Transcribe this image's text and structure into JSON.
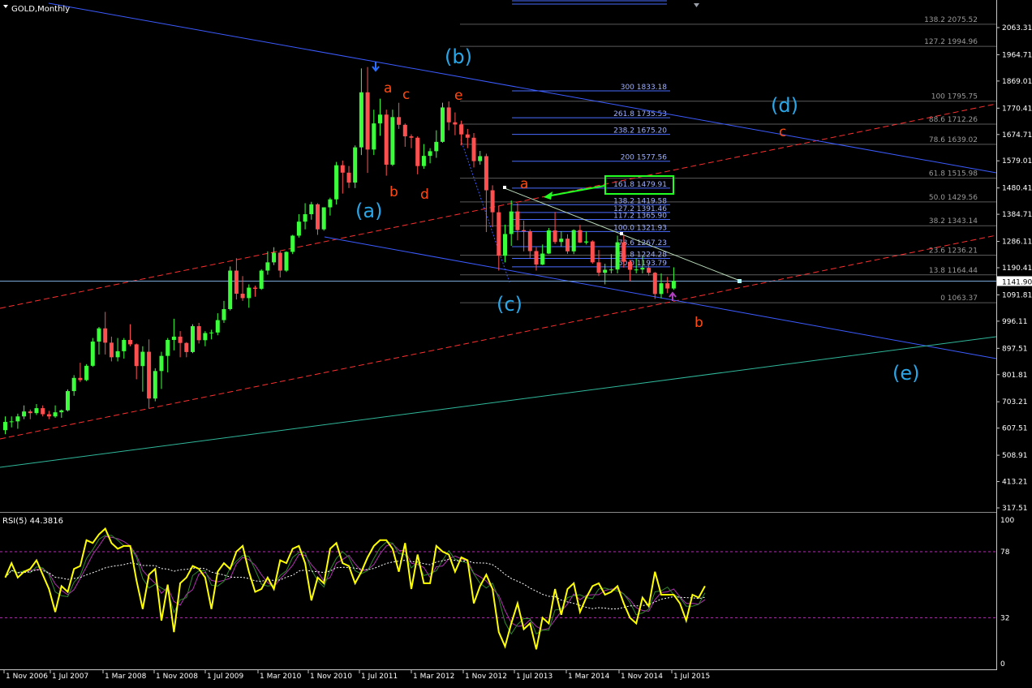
{
  "chart_data": {
    "type": "candlestick",
    "symbol_title": "GOLD,Monthly",
    "price_axis_ticks": [
      "2063.31",
      "1964.71",
      "1869.01",
      "1770.41",
      "1674.71",
      "1579.01",
      "1480.41",
      "1384.71",
      "1286.11",
      "1190.41",
      "1091.81",
      "996.11",
      "897.51",
      "801.81",
      "703.21",
      "607.51",
      "508.91",
      "413.21",
      "317.51"
    ],
    "current_price": "1141.90",
    "time_axis_ticks": [
      "1 Nov 2006",
      "1 Jul 2007",
      "1 Mar 2008",
      "1 Nov 2008",
      "1 Jul 2009",
      "1 Mar 2010",
      "1 Nov 2010",
      "1 Jul 2011",
      "1 Mar 2012",
      "1 Nov 2012",
      "1 Jul 2013",
      "1 Mar 2014",
      "1 Nov 2014",
      "1 Jul 2015"
    ],
    "candles": [
      {
        "d": "2006-11",
        "o": 600,
        "h": 650,
        "l": 585,
        "c": 630
      },
      {
        "d": "2006-12",
        "o": 630,
        "h": 650,
        "l": 610,
        "c": 632
      },
      {
        "d": "2007-01",
        "o": 632,
        "h": 660,
        "l": 605,
        "c": 650
      },
      {
        "d": "2007-02",
        "o": 650,
        "h": 690,
        "l": 640,
        "c": 668
      },
      {
        "d": "2007-03",
        "o": 668,
        "h": 675,
        "l": 640,
        "c": 662
      },
      {
        "d": "2007-04",
        "o": 662,
        "h": 695,
        "l": 655,
        "c": 680
      },
      {
        "d": "2007-05",
        "o": 680,
        "h": 690,
        "l": 650,
        "c": 658
      },
      {
        "d": "2007-06",
        "o": 658,
        "h": 670,
        "l": 640,
        "c": 650
      },
      {
        "d": "2007-07",
        "o": 650,
        "h": 690,
        "l": 645,
        "c": 665
      },
      {
        "d": "2007-08",
        "o": 665,
        "h": 675,
        "l": 645,
        "c": 672
      },
      {
        "d": "2007-09",
        "o": 672,
        "h": 748,
        "l": 668,
        "c": 742
      },
      {
        "d": "2007-10",
        "o": 742,
        "h": 800,
        "l": 725,
        "c": 790
      },
      {
        "d": "2007-11",
        "o": 790,
        "h": 845,
        "l": 775,
        "c": 782
      },
      {
        "d": "2007-12",
        "o": 782,
        "h": 840,
        "l": 778,
        "c": 834
      },
      {
        "d": "2008-01",
        "o": 834,
        "h": 935,
        "l": 830,
        "c": 922
      },
      {
        "d": "2008-02",
        "o": 922,
        "h": 975,
        "l": 875,
        "c": 970
      },
      {
        "d": "2008-03",
        "o": 970,
        "h": 1030,
        "l": 875,
        "c": 918
      },
      {
        "d": "2008-04",
        "o": 918,
        "h": 940,
        "l": 850,
        "c": 865
      },
      {
        "d": "2008-05",
        "o": 865,
        "h": 935,
        "l": 850,
        "c": 887
      },
      {
        "d": "2008-06",
        "o": 887,
        "h": 935,
        "l": 860,
        "c": 928
      },
      {
        "d": "2008-07",
        "o": 928,
        "h": 985,
        "l": 905,
        "c": 912
      },
      {
        "d": "2008-08",
        "o": 912,
        "h": 915,
        "l": 785,
        "c": 833
      },
      {
        "d": "2008-09",
        "o": 833,
        "h": 905,
        "l": 740,
        "c": 885
      },
      {
        "d": "2008-10",
        "o": 885,
        "h": 930,
        "l": 680,
        "c": 715
      },
      {
        "d": "2008-11",
        "o": 715,
        "h": 825,
        "l": 705,
        "c": 815
      },
      {
        "d": "2008-12",
        "o": 815,
        "h": 885,
        "l": 750,
        "c": 870
      },
      {
        "d": "2009-01",
        "o": 870,
        "h": 935,
        "l": 810,
        "c": 928
      },
      {
        "d": "2009-02",
        "o": 928,
        "h": 1005,
        "l": 890,
        "c": 940
      },
      {
        "d": "2009-03",
        "o": 940,
        "h": 960,
        "l": 865,
        "c": 917
      },
      {
        "d": "2009-04",
        "o": 917,
        "h": 920,
        "l": 865,
        "c": 884
      },
      {
        "d": "2009-05",
        "o": 884,
        "h": 985,
        "l": 880,
        "c": 978
      },
      {
        "d": "2009-06",
        "o": 978,
        "h": 990,
        "l": 915,
        "c": 927
      },
      {
        "d": "2009-07",
        "o": 927,
        "h": 960,
        "l": 905,
        "c": 953
      },
      {
        "d": "2009-08",
        "o": 953,
        "h": 965,
        "l": 930,
        "c": 955
      },
      {
        "d": "2009-09",
        "o": 955,
        "h": 1025,
        "l": 945,
        "c": 1000
      },
      {
        "d": "2009-10",
        "o": 1000,
        "h": 1070,
        "l": 990,
        "c": 1040
      },
      {
        "d": "2009-11",
        "o": 1040,
        "h": 1195,
        "l": 1035,
        "c": 1180
      },
      {
        "d": "2009-12",
        "o": 1180,
        "h": 1225,
        "l": 1075,
        "c": 1096
      },
      {
        "d": "2010-01",
        "o": 1096,
        "h": 1160,
        "l": 1070,
        "c": 1080
      },
      {
        "d": "2010-02",
        "o": 1080,
        "h": 1130,
        "l": 1045,
        "c": 1118
      },
      {
        "d": "2010-03",
        "o": 1118,
        "h": 1125,
        "l": 1085,
        "c": 1114
      },
      {
        "d": "2010-04",
        "o": 1114,
        "h": 1185,
        "l": 1110,
        "c": 1180
      },
      {
        "d": "2010-05",
        "o": 1180,
        "h": 1250,
        "l": 1165,
        "c": 1210
      },
      {
        "d": "2010-06",
        "o": 1210,
        "h": 1265,
        "l": 1200,
        "c": 1245
      },
      {
        "d": "2010-07",
        "o": 1245,
        "h": 1250,
        "l": 1155,
        "c": 1180
      },
      {
        "d": "2010-08",
        "o": 1180,
        "h": 1250,
        "l": 1175,
        "c": 1248
      },
      {
        "d": "2010-09",
        "o": 1248,
        "h": 1310,
        "l": 1240,
        "c": 1307
      },
      {
        "d": "2010-10",
        "o": 1307,
        "h": 1385,
        "l": 1300,
        "c": 1358
      },
      {
        "d": "2010-11",
        "o": 1358,
        "h": 1425,
        "l": 1330,
        "c": 1385
      },
      {
        "d": "2010-12",
        "o": 1385,
        "h": 1430,
        "l": 1365,
        "c": 1421
      },
      {
        "d": "2011-01",
        "o": 1421,
        "h": 1425,
        "l": 1310,
        "c": 1330
      },
      {
        "d": "2011-02",
        "o": 1330,
        "h": 1410,
        "l": 1325,
        "c": 1410
      },
      {
        "d": "2011-03",
        "o": 1410,
        "h": 1445,
        "l": 1380,
        "c": 1439
      },
      {
        "d": "2011-04",
        "o": 1439,
        "h": 1575,
        "l": 1420,
        "c": 1563
      },
      {
        "d": "2011-05",
        "o": 1563,
        "h": 1580,
        "l": 1460,
        "c": 1536
      },
      {
        "d": "2011-06",
        "o": 1536,
        "h": 1560,
        "l": 1480,
        "c": 1500
      },
      {
        "d": "2011-07",
        "o": 1500,
        "h": 1635,
        "l": 1480,
        "c": 1628
      },
      {
        "d": "2011-08",
        "o": 1628,
        "h": 1915,
        "l": 1600,
        "c": 1828
      },
      {
        "d": "2011-09",
        "o": 1828,
        "h": 1920,
        "l": 1535,
        "c": 1620
      },
      {
        "d": "2011-10",
        "o": 1620,
        "h": 1765,
        "l": 1600,
        "c": 1715
      },
      {
        "d": "2011-11",
        "o": 1715,
        "h": 1805,
        "l": 1670,
        "c": 1747
      },
      {
        "d": "2011-12",
        "o": 1747,
        "h": 1765,
        "l": 1525,
        "c": 1565
      },
      {
        "d": "2012-01",
        "o": 1565,
        "h": 1765,
        "l": 1560,
        "c": 1738
      },
      {
        "d": "2012-02",
        "o": 1738,
        "h": 1790,
        "l": 1695,
        "c": 1710
      },
      {
        "d": "2012-03",
        "o": 1710,
        "h": 1715,
        "l": 1630,
        "c": 1668
      },
      {
        "d": "2012-04",
        "o": 1668,
        "h": 1675,
        "l": 1625,
        "c": 1663
      },
      {
        "d": "2012-05",
        "o": 1663,
        "h": 1668,
        "l": 1530,
        "c": 1560
      },
      {
        "d": "2012-06",
        "o": 1560,
        "h": 1640,
        "l": 1550,
        "c": 1597
      },
      {
        "d": "2012-07",
        "o": 1597,
        "h": 1625,
        "l": 1570,
        "c": 1614
      },
      {
        "d": "2012-08",
        "o": 1614,
        "h": 1690,
        "l": 1590,
        "c": 1648
      },
      {
        "d": "2012-09",
        "o": 1648,
        "h": 1790,
        "l": 1645,
        "c": 1773
      },
      {
        "d": "2012-10",
        "o": 1773,
        "h": 1795,
        "l": 1690,
        "c": 1719
      },
      {
        "d": "2012-11",
        "o": 1719,
        "h": 1755,
        "l": 1672,
        "c": 1711
      },
      {
        "d": "2012-12",
        "o": 1711,
        "h": 1725,
        "l": 1635,
        "c": 1675
      },
      {
        "d": "2013-01",
        "o": 1675,
        "h": 1695,
        "l": 1625,
        "c": 1663
      },
      {
        "d": "2013-02",
        "o": 1663,
        "h": 1680,
        "l": 1555,
        "c": 1578
      },
      {
        "d": "2013-03",
        "o": 1578,
        "h": 1615,
        "l": 1565,
        "c": 1596
      },
      {
        "d": "2013-04",
        "o": 1596,
        "h": 1605,
        "l": 1320,
        "c": 1472
      },
      {
        "d": "2013-05",
        "o": 1472,
        "h": 1490,
        "l": 1338,
        "c": 1392
      },
      {
        "d": "2013-06",
        "o": 1392,
        "h": 1415,
        "l": 1180,
        "c": 1234
      },
      {
        "d": "2013-07",
        "o": 1234,
        "h": 1347,
        "l": 1210,
        "c": 1313
      },
      {
        "d": "2013-08",
        "o": 1313,
        "h": 1435,
        "l": 1270,
        "c": 1395
      },
      {
        "d": "2013-09",
        "o": 1395,
        "h": 1425,
        "l": 1290,
        "c": 1327
      },
      {
        "d": "2013-10",
        "o": 1327,
        "h": 1362,
        "l": 1250,
        "c": 1323
      },
      {
        "d": "2013-11",
        "o": 1323,
        "h": 1330,
        "l": 1225,
        "c": 1251
      },
      {
        "d": "2013-12",
        "o": 1251,
        "h": 1265,
        "l": 1180,
        "c": 1202
      },
      {
        "d": "2014-01",
        "o": 1202,
        "h": 1275,
        "l": 1200,
        "c": 1242
      },
      {
        "d": "2014-02",
        "o": 1242,
        "h": 1335,
        "l": 1240,
        "c": 1326
      },
      {
        "d": "2014-03",
        "o": 1326,
        "h": 1393,
        "l": 1277,
        "c": 1284
      },
      {
        "d": "2014-04",
        "o": 1284,
        "h": 1323,
        "l": 1268,
        "c": 1296
      },
      {
        "d": "2014-05",
        "o": 1296,
        "h": 1312,
        "l": 1241,
        "c": 1250
      },
      {
        "d": "2014-06",
        "o": 1250,
        "h": 1330,
        "l": 1240,
        "c": 1327
      },
      {
        "d": "2014-07",
        "o": 1327,
        "h": 1346,
        "l": 1280,
        "c": 1282
      },
      {
        "d": "2014-08",
        "o": 1282,
        "h": 1322,
        "l": 1275,
        "c": 1286
      },
      {
        "d": "2014-09",
        "o": 1286,
        "h": 1290,
        "l": 1205,
        "c": 1210
      },
      {
        "d": "2014-10",
        "o": 1210,
        "h": 1255,
        "l": 1160,
        "c": 1172
      },
      {
        "d": "2014-11",
        "o": 1172,
        "h": 1205,
        "l": 1130,
        "c": 1183
      },
      {
        "d": "2014-12",
        "o": 1183,
        "h": 1240,
        "l": 1170,
        "c": 1184
      },
      {
        "d": "2015-01",
        "o": 1184,
        "h": 1307,
        "l": 1170,
        "c": 1283
      },
      {
        "d": "2015-02",
        "o": 1283,
        "h": 1308,
        "l": 1191,
        "c": 1212
      },
      {
        "d": "2015-03",
        "o": 1212,
        "h": 1219,
        "l": 1142,
        "c": 1183
      },
      {
        "d": "2015-04",
        "o": 1183,
        "h": 1224,
        "l": 1170,
        "c": 1184
      },
      {
        "d": "2015-05",
        "o": 1184,
        "h": 1232,
        "l": 1170,
        "c": 1190
      },
      {
        "d": "2015-06",
        "o": 1190,
        "h": 1205,
        "l": 1162,
        "c": 1172
      },
      {
        "d": "2015-07",
        "o": 1172,
        "h": 1175,
        "l": 1077,
        "c": 1095
      },
      {
        "d": "2015-08",
        "o": 1095,
        "h": 1170,
        "l": 1080,
        "c": 1134
      },
      {
        "d": "2015-09",
        "o": 1134,
        "h": 1157,
        "l": 1098,
        "c": 1115
      },
      {
        "d": "2015-10",
        "o": 1115,
        "h": 1192,
        "l": 1110,
        "c": 1142
      }
    ],
    "fib_retracement_right": [
      {
        "label": "138.2 2075.52",
        "price": 2075.52
      },
      {
        "label": "127.2 1994.96",
        "price": 1994.96
      },
      {
        "label": "100 1795.75",
        "price": 1795.75
      },
      {
        "label": "88.6 1712.26",
        "price": 1712.26
      },
      {
        "label": "78.6 1639.02",
        "price": 1639.02
      },
      {
        "label": "61.8 1515.98",
        "price": 1515.98
      },
      {
        "label": "50.0 1429.56",
        "price": 1429.56
      },
      {
        "label": "38.2 1343.14",
        "price": 1343.14
      },
      {
        "label": "23.6 1236.21",
        "price": 1236.21
      },
      {
        "label": "13.8 1164.44",
        "price": 1164.44
      },
      {
        "label": "0 1063.37",
        "price": 1063.37
      }
    ],
    "fib_expansion_mid": [
      {
        "label": "300 1833.18",
        "price": 1833.18
      },
      {
        "label": "261.8 1735.53",
        "price": 1735.53
      },
      {
        "label": "238.2 1675.20",
        "price": 1675.2
      },
      {
        "label": "200 1577.56",
        "price": 1577.56
      },
      {
        "label": "161.8 1479.91",
        "price": 1479.91
      },
      {
        "label": "138.2 1419.58",
        "price": 1419.58
      },
      {
        "label": "127.2 1391.46",
        "price": 1391.46
      },
      {
        "label": "117.2 1365.90",
        "price": 1365.9
      },
      {
        "label": "100.0 1321.93",
        "price": 1321.93
      },
      {
        "label": "78.6 1267.23",
        "price": 1267.23
      },
      {
        "label": "61.8 1224.28",
        "price": 1224.28
      },
      {
        "label": "50.0 1193.79",
        "price": 1193.79
      }
    ],
    "wave_labels_big": [
      "(a)",
      "(b)",
      "(c)",
      "(d)",
      "(e)"
    ],
    "wave_labels_small": [
      "a",
      "b",
      "c",
      "d",
      "e",
      "a",
      "b",
      "c"
    ],
    "rsi": {
      "title": "RSI(5) 44.3816",
      "axis_ticks": [
        "100",
        "78",
        "32",
        "0"
      ],
      "levels": [
        78,
        32
      ],
      "values": [
        60,
        70,
        60,
        64,
        66,
        72,
        62,
        52,
        36,
        54,
        50,
        66,
        68,
        86,
        84,
        90,
        94,
        84,
        80,
        82,
        82,
        58,
        38,
        62,
        66,
        30,
        55,
        22,
        56,
        60,
        68,
        66,
        60,
        38,
        64,
        70,
        66,
        78,
        82,
        64,
        50,
        52,
        60,
        52,
        72,
        70,
        80,
        82,
        70,
        44,
        60,
        56,
        80,
        84,
        70,
        68,
        56,
        64,
        74,
        82,
        86,
        86,
        80,
        64,
        84,
        52,
        76,
        56,
        56,
        82,
        78,
        76,
        64,
        74,
        72,
        42,
        54,
        62,
        52,
        22,
        12,
        28,
        42,
        24,
        28,
        10,
        32,
        28,
        52,
        34,
        52,
        56,
        36,
        46,
        54,
        56,
        48,
        50,
        54,
        42,
        32,
        28,
        46,
        40,
        64,
        48,
        48,
        48,
        42,
        30,
        48,
        46,
        54
      ]
    },
    "colors": {
      "bull": "#3aff3a",
      "bear": "#ff4f4f",
      "background": "#000000",
      "rsi_line": "#ffff00",
      "channel": "#ff3030",
      "trend_blue": "#3b5bff",
      "teal": "#2fb89a",
      "wave_big": "#2aa7e8",
      "wave_small": "#ff4a12",
      "highlight": "#22ff22"
    }
  }
}
